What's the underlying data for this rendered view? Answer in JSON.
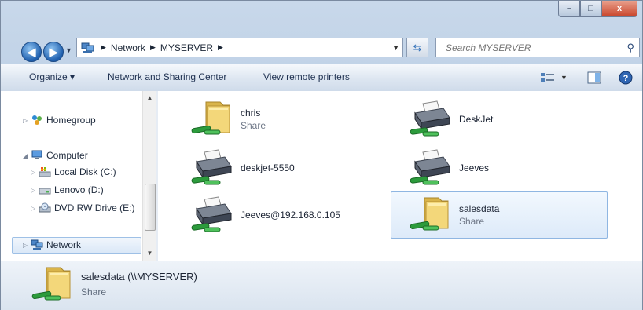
{
  "window": {
    "caption_buttons": {
      "minimize": "–",
      "maximize": "□",
      "close": "x"
    }
  },
  "address_bar": {
    "breadcrumbs": [
      "Network",
      "MYSERVER"
    ],
    "search_placeholder": "Search MYSERVER"
  },
  "toolbar": {
    "organize": "Organize ▾",
    "network_sharing": "Network and Sharing Center",
    "view_remote_printers": "View remote printers"
  },
  "nav": {
    "homegroup": "Homegroup",
    "computer": "Computer",
    "local_disk": "Local Disk (C:)",
    "lenovo": "Lenovo (D:)",
    "dvd": "DVD RW Drive (E:)",
    "network": "Network"
  },
  "items": [
    {
      "name": "chris",
      "sub": "Share",
      "icon": "folder-share-icon"
    },
    {
      "name": "DeskJet",
      "sub": "",
      "icon": "printer-share-icon"
    },
    {
      "name": "deskjet-5550",
      "sub": "",
      "icon": "printer-share-icon"
    },
    {
      "name": "Jeeves",
      "sub": "",
      "icon": "printer-share-icon"
    },
    {
      "name": "Jeeves@192.168.0.105",
      "sub": "",
      "icon": "printer-share-icon"
    },
    {
      "name": "salesdata",
      "sub": "Share",
      "icon": "folder-share-icon"
    }
  ],
  "details": {
    "name": "salesdata (\\\\MYSERVER)",
    "sub": "Share"
  },
  "colors": {
    "selection": "#ddeaf9",
    "toolbar": "#dde6f1",
    "window_frame": "#b4c9e2"
  }
}
